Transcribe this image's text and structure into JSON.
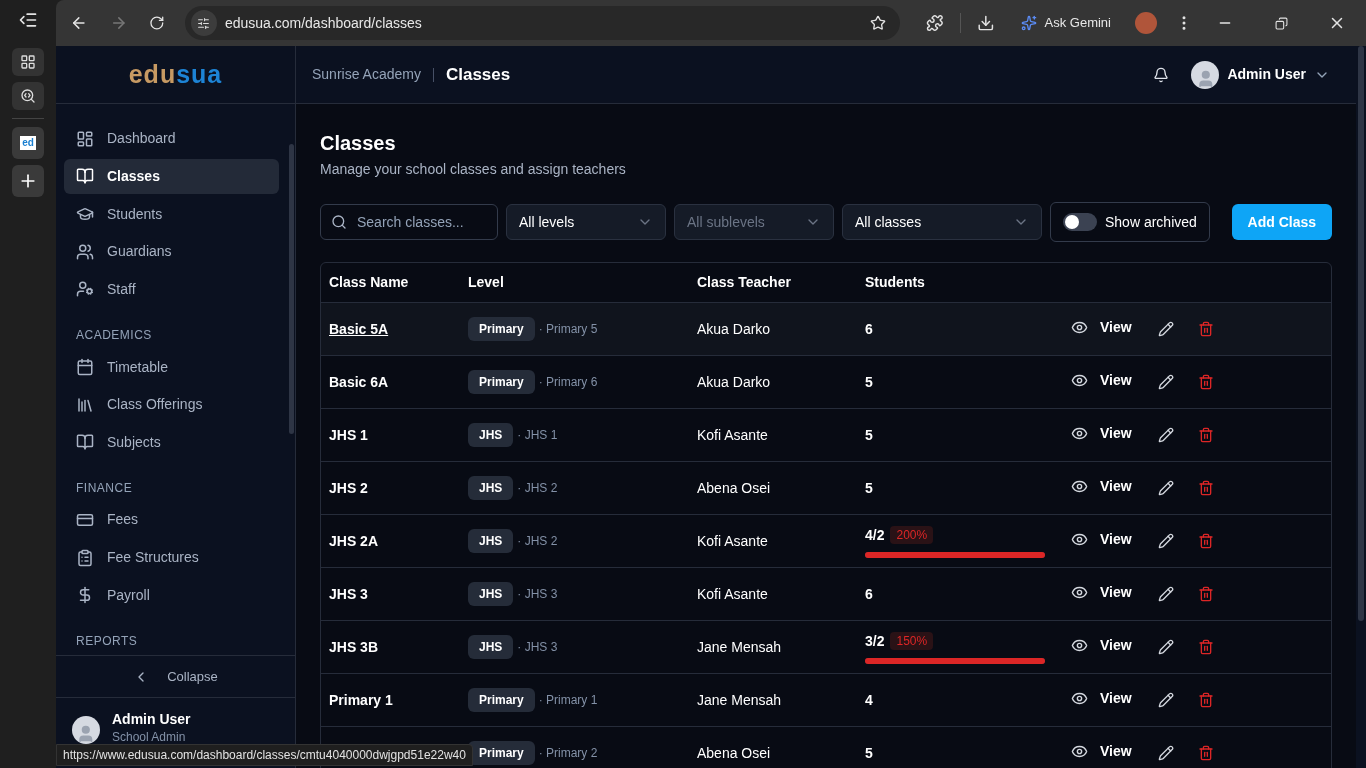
{
  "browser": {
    "url": "edusua.com/dashboard/classes",
    "assistant": "Ask Gemini",
    "status_url": "https://www.edusua.com/dashboard/classes/cmtu4040000dwjgpd51e22w40",
    "favicon": "ed"
  },
  "sidebar": {
    "logo_left": "edu",
    "logo_right": "sua",
    "items": [
      {
        "kind": "link",
        "label": "Dashboard",
        "selected": false
      },
      {
        "kind": "link",
        "label": "Classes",
        "selected": true
      },
      {
        "kind": "link",
        "label": "Students",
        "selected": false
      },
      {
        "kind": "link",
        "label": "Guardians",
        "selected": false
      },
      {
        "kind": "link",
        "label": "Staff",
        "selected": false
      },
      {
        "kind": "heading",
        "label": "ACADEMICS"
      },
      {
        "kind": "link",
        "label": "Timetable",
        "selected": false
      },
      {
        "kind": "link",
        "label": "Class Offerings",
        "selected": false
      },
      {
        "kind": "link",
        "label": "Subjects",
        "selected": false
      },
      {
        "kind": "heading",
        "label": "FINANCE"
      },
      {
        "kind": "link",
        "label": "Fees",
        "selected": false
      },
      {
        "kind": "link",
        "label": "Fee Structures",
        "selected": false
      },
      {
        "kind": "link",
        "label": "Payroll",
        "selected": false
      },
      {
        "kind": "heading",
        "label": "REPORTS"
      }
    ],
    "collapse": "Collapse",
    "user": {
      "name": "Admin User",
      "role": "School Admin"
    }
  },
  "header": {
    "school": "Sunrise Academy",
    "page": "Classes",
    "user": "Admin User"
  },
  "page": {
    "title": "Classes",
    "subtitle": "Manage your school classes and assign teachers"
  },
  "filters": {
    "search_placeholder": "Search classes...",
    "selects": [
      {
        "value": "All levels",
        "disabled": false
      },
      {
        "value": "All sublevels",
        "disabled": true
      },
      {
        "value": "All classes",
        "disabled": false
      }
    ],
    "archived": {
      "label": "Show archived",
      "on": false
    },
    "add_button": "Add Class"
  },
  "table": {
    "columns": [
      "Class Name",
      "Level",
      "Class Teacher",
      "Students"
    ],
    "rows": [
      {
        "name": "Basic 5A",
        "level_name": "Primary",
        "sublevel": "· Primary 5",
        "teacher": "Akua Darko",
        "students": "6",
        "view": "View",
        "highlighted": true
      },
      {
        "name": "Basic 6A",
        "level_name": "Primary",
        "sublevel": "· Primary 6",
        "teacher": "Akua Darko",
        "students": "5",
        "view": "View",
        "highlighted": false
      },
      {
        "name": "JHS 1",
        "level_name": "JHS",
        "sublevel": "· JHS 1",
        "teacher": "Kofi Asante",
        "students": "5",
        "view": "View",
        "highlighted": false
      },
      {
        "name": "JHS 2",
        "level_name": "JHS",
        "sublevel": "· JHS 2",
        "teacher": "Abena Osei",
        "students": "5",
        "view": "View",
        "highlighted": false
      },
      {
        "name": "JHS 2A",
        "level_name": "JHS",
        "sublevel": "· JHS 2",
        "teacher": "Kofi Asante",
        "students": "4/2",
        "percent": "200%",
        "level": 1,
        "view": "View",
        "highlighted": false
      },
      {
        "name": "JHS 3",
        "level_name": "JHS",
        "sublevel": "· JHS 3",
        "teacher": "Kofi Asante",
        "students": "6",
        "view": "View",
        "highlighted": false
      },
      {
        "name": "JHS 3B",
        "level_name": "JHS",
        "sublevel": "· JHS 3",
        "teacher": "Jane Mensah",
        "students": "3/2",
        "percent": "150%",
        "level": 1,
        "view": "View",
        "highlighted": false
      },
      {
        "name": "Primary 1",
        "level_name": "Primary",
        "sublevel": "· Primary 1",
        "teacher": "Jane Mensah",
        "students": "4",
        "view": "View",
        "highlighted": false
      },
      {
        "level_name": "Primary",
        "sublevel": "· Primary 2",
        "teacher": "Abena Osei",
        "students": "5",
        "view": "View"
      }
    ]
  }
}
